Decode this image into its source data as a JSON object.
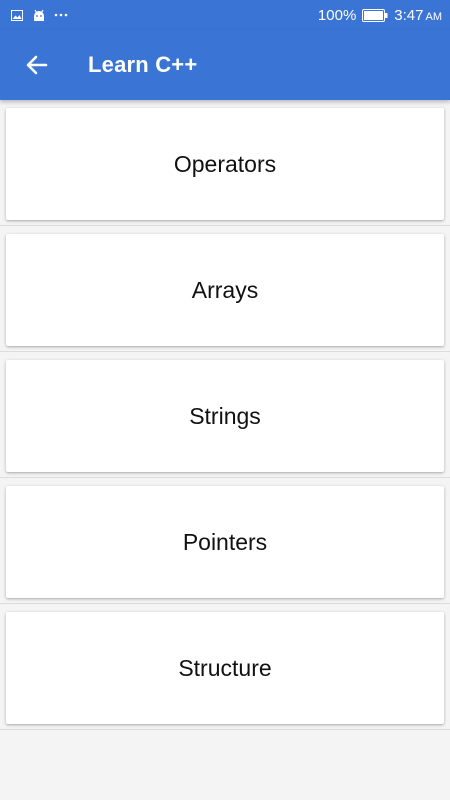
{
  "status_bar": {
    "notification_icons": [
      "image-icon",
      "android-icon",
      "more-dots-icon"
    ],
    "battery": "100%",
    "time": "3:47",
    "ampm": "AM"
  },
  "app_bar": {
    "title": "Learn C++",
    "back_icon": "arrow-left-icon"
  },
  "topics": [
    {
      "label": "Operators"
    },
    {
      "label": "Arrays"
    },
    {
      "label": "Strings"
    },
    {
      "label": "Pointers"
    },
    {
      "label": "Structure"
    }
  ],
  "colors": {
    "primary": "#3a74d4",
    "background": "#f4f4f4",
    "card": "#ffffff"
  }
}
